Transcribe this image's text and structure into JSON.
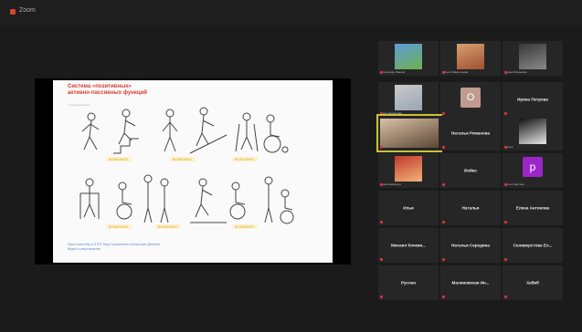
{
  "window": {
    "title": "Zoom"
  },
  "slide": {
    "title_lines": [
      "Система «позитивных»",
      "активно-пассивных функций"
    ],
    "subtitle": "и сотрудничество",
    "figure_labels": [
      "ВОЗМОЖНО",
      "ВОЗМОЖНО",
      "ВОЗМОЖНО",
      "ВОЗМОЖНО",
      "ВОЗМОЖНО",
      "ВОЗМОЖНО"
    ],
    "link_lines": [
      "https://www.Мы-и-ЭТОТ-Мир.Упражнения.интереснее.Детский",
      "Видео-и-мероприятие"
    ]
  },
  "participants": [
    {
      "name": "",
      "caption": "Александр Иванов",
      "kind": "video"
    },
    {
      "name": "",
      "caption": "Ольга Лаврентьева",
      "kind": "video"
    },
    {
      "name": "",
      "caption": "Ирина Романова",
      "kind": "video"
    },
    {
      "name": "",
      "caption": "Анна Некрасова",
      "kind": "video"
    },
    {
      "name": "",
      "caption": "",
      "kind": "letter",
      "letter": "O"
    },
    {
      "name": "Ирина Петрова",
      "caption": "",
      "kind": "name"
    },
    {
      "name": "",
      "caption": "",
      "kind": "video-active"
    },
    {
      "name": "Наталья Романова",
      "caption": "",
      "kind": "name"
    },
    {
      "name": "",
      "caption": "Ольга",
      "kind": "video"
    },
    {
      "name": "",
      "caption": "Анна Ковальчук",
      "kind": "video"
    },
    {
      "name": "Войко",
      "caption": "",
      "kind": "name"
    },
    {
      "name": "",
      "caption": "Ольга Карпова",
      "kind": "letter",
      "letter": "p"
    },
    {
      "name": "Илья",
      "caption": "",
      "kind": "name"
    },
    {
      "name": "Наталья",
      "caption": "",
      "kind": "name"
    },
    {
      "name": "Елена Антонова",
      "caption": "",
      "kind": "name"
    },
    {
      "name": "Михаил Кочкин...",
      "caption": "",
      "kind": "name"
    },
    {
      "name": "Наталья Середина",
      "caption": "",
      "kind": "name"
    },
    {
      "name": "Селиверстова Ел...",
      "caption": "",
      "kind": "name"
    },
    {
      "name": "Руслан",
      "caption": "",
      "kind": "name"
    },
    {
      "name": "Малиновская Ин...",
      "caption": "",
      "kind": "name"
    },
    {
      "name": "Хабиб",
      "caption": "",
      "kind": "name"
    }
  ]
}
